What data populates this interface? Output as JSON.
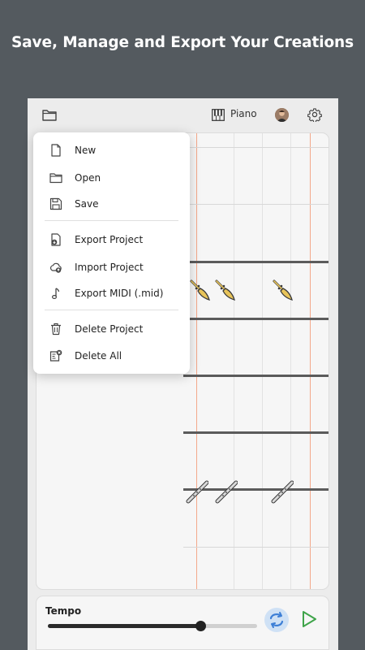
{
  "headline": "Save, Manage and Export Your Creations",
  "topbar": {
    "folder_icon": "folder-icon",
    "instrument_icon": "piano-icon",
    "instrument_label": "Piano",
    "avatar_icon": "avatar",
    "settings_icon": "gear-icon"
  },
  "menu": {
    "items": [
      {
        "label": "New",
        "icon": "file-icon"
      },
      {
        "label": "Open",
        "icon": "folder-open-icon"
      },
      {
        "label": "Save",
        "icon": "floppy-disk-icon"
      },
      {
        "label": "Export Project",
        "icon": "file-export-icon"
      },
      {
        "label": "Import Project",
        "icon": "cloud-upload-icon"
      },
      {
        "label": "Export MIDI (.mid)",
        "icon": "music-note-icon"
      },
      {
        "label": "Delete Project",
        "icon": "trash-icon"
      },
      {
        "label": "Delete All",
        "icon": "delete-all-icon"
      }
    ]
  },
  "grid": {
    "instruments": [
      "trumpet",
      "flute"
    ]
  },
  "player": {
    "tempo_label": "Tempo",
    "tempo_fraction": 0.73,
    "loop_icon": "loop-icon",
    "play_icon": "play-icon"
  },
  "colors": {
    "background": "#545a5f",
    "accent_orange": "#f3a88a",
    "play_green": "#3fa44a",
    "loop_blue": "#3d7fd6"
  }
}
